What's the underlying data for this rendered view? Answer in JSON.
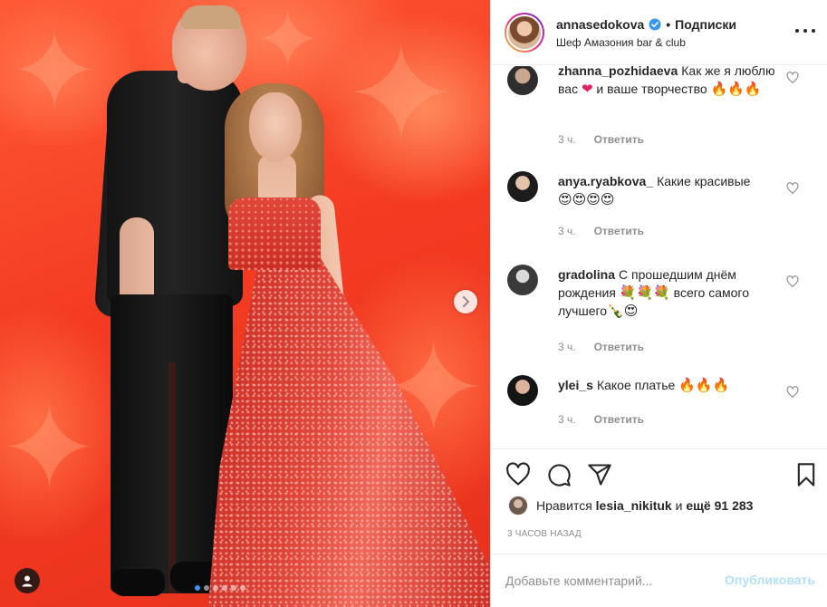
{
  "post": {
    "photo_alt": "",
    "carousel": {
      "count": 6,
      "active_index": 0
    }
  },
  "header": {
    "username": "annasedokova",
    "separator": "•",
    "follow_label": "Подписки",
    "location": "Шеф Амазония bar & club",
    "verified_icon": "verified-badge-icon",
    "more_icon": "more-options-icon"
  },
  "comments": [
    {
      "user": "zhanna_pozhidaeva",
      "text": "Как же я люблю вас",
      "emoji_after": "❤",
      "text2": " и ваше творчество ",
      "emoji_end": "🔥🔥🔥",
      "time": "3 ч.",
      "reply": "Ответить",
      "avatar_color": "#3b3b3b"
    },
    {
      "user": "anya.ryabkova_",
      "text": "Какие красивые",
      "emoji_after": "",
      "text2": "",
      "emoji_end": "😍😍😍😍",
      "time": "3 ч.",
      "reply": "Ответить",
      "avatar_color": "#2a2a2a"
    },
    {
      "user": "gradolina",
      "text": "С прошедшим днём рождения",
      "emoji_after": "💐💐💐",
      "text2": " всего самого лучшего",
      "emoji_end": "🍾😍",
      "time": "3 ч.",
      "reply": "Ответить",
      "avatar_color": "#555555"
    },
    {
      "user": "ylei_s",
      "text": "Какое платье",
      "emoji_after": "",
      "text2": "",
      "emoji_end": "🔥🔥🔥",
      "time": "3 ч.",
      "reply": "Ответить",
      "avatar_color": "#1f1f1f"
    }
  ],
  "actions": {
    "like_icon": "heart-icon",
    "comment_icon": "comment-icon",
    "share_icon": "share-icon",
    "save_icon": "bookmark-icon"
  },
  "likes": {
    "prefix": "Нравится",
    "user": "lesia_nikituk",
    "middle": "и",
    "rest": "ещё 91 283"
  },
  "time_ago": "3 ЧАСОВ НАЗАД",
  "add_comment": {
    "placeholder": "Добавьте комментарий...",
    "publish_label": "Опубликовать"
  },
  "colors": {
    "accent": "#3897f0",
    "publish_disabled": "#b2dffc",
    "muted": "#8e8e8e",
    "text": "#262626",
    "border": "#efefef"
  }
}
